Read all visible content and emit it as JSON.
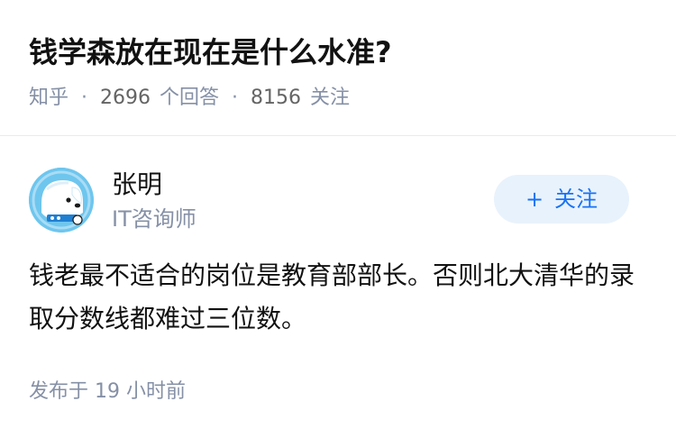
{
  "question": {
    "title": "钱学森放在现在是什么水准?",
    "source": "知乎",
    "separator": "·",
    "answer_count": "2696",
    "answer_label": "个回答",
    "follower_count": "8156",
    "follower_label": "关注"
  },
  "answer": {
    "author": {
      "name": "张明",
      "headline": "IT咨询师",
      "avatar_icon": "cartoon-dog-avatar-icon"
    },
    "follow_button": {
      "icon": "+",
      "label": "关注"
    },
    "content": "钱老最不适合的岗位是教育部部长。否则北大清华的录取分数线都难过三位数。",
    "time_prefix": "发布于",
    "time_value": "19 小时前"
  },
  "colors": {
    "primary_text": "#121212",
    "secondary_text": "#8590a6",
    "brand_blue": "#1772f6",
    "button_bg": "#e8f2fc",
    "divider": "#ebebeb"
  }
}
